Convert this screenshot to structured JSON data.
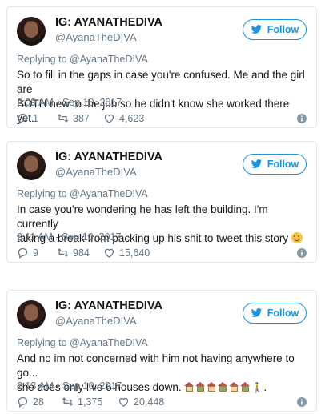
{
  "colors": {
    "accent": "#1b95e0",
    "muted": "#657786",
    "text": "#14171a",
    "border": "#e1e8ed"
  },
  "tweets": [
    {
      "name": "IG: AYANATHEDIVA",
      "handle": "@AyanaTheDIVA",
      "follow_label": "Follow",
      "replying": "Replying to @AyanaTheDIVA",
      "text_1": "So to fill in the gaps in case you're confused. Me and the girl are",
      "text_2": "BOTH new to the job so he didn't know she worked there yet.",
      "time": "2:09 AM - Sep 10, 2017",
      "replies": "1",
      "retweets": "387",
      "likes": "4,623"
    },
    {
      "name": "IG: AYANATHEDIVA",
      "handle": "@AyanaTheDIVA",
      "follow_label": "Follow",
      "replying": "Replying to @AyanaTheDIVA",
      "text_1": "In case you're wondering he has left the building. I'm currently",
      "text_2": "taking a break from packing up his shit to tweet this story",
      "time": "2:11 AM - Sep 10, 2017",
      "replies": "9",
      "retweets": "984",
      "likes": "15,640"
    },
    {
      "name": "IG: AYANATHEDIVA",
      "handle": "@AyanaTheDIVA",
      "follow_label": "Follow",
      "replying": "Replying to @AyanaTheDIVA",
      "text_1": "And no im not concerned with him not having anywhere to go...",
      "text_2": "she does only live 6 houses down.",
      "text_2_end": ".",
      "time": "2:13 AM - Sep 10, 2017",
      "replies": "28",
      "retweets": "1,375",
      "likes": "20,448"
    }
  ],
  "icons": [
    "bird-icon",
    "reply-icon",
    "retweet-icon",
    "heart-icon",
    "info-icon",
    "smile-emoji",
    "house-emoji",
    "walking-person-emoji"
  ]
}
